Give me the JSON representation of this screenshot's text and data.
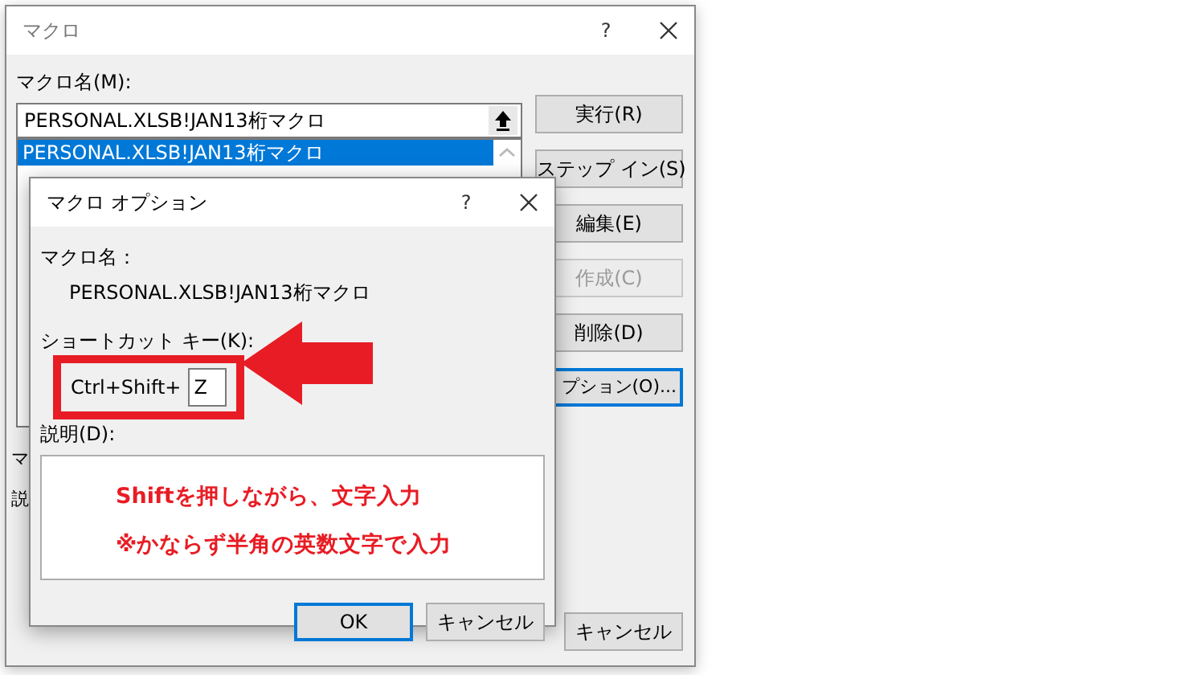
{
  "macro_dialog": {
    "title": "マクロ",
    "help": "?",
    "name_label": "マクロ名(M):",
    "name_value": "PERSONAL.XLSB!JAN13桁マクロ",
    "list_items": [
      {
        "text": "PERSONAL.XLSB!JAN13桁マクロ",
        "selected": true
      }
    ],
    "buttons": [
      {
        "label": "実行(R)",
        "disabled": false,
        "focused": false
      },
      {
        "label": "ステップ イン(S)",
        "disabled": false,
        "focused": false
      },
      {
        "label": "編集(E)",
        "disabled": false,
        "focused": false
      },
      {
        "label": "作成(C)",
        "disabled": true,
        "focused": false
      },
      {
        "label": "削除(D)",
        "disabled": false,
        "focused": false
      },
      {
        "label": "プション(O)...",
        "disabled": false,
        "focused": true
      }
    ],
    "partial_labels": [
      "マ",
      "説"
    ],
    "cancel_button": "キャンセル"
  },
  "options_dialog": {
    "title": "マクロ オプション",
    "help": "?",
    "name_label": "マクロ名：",
    "name_value": "PERSONAL.XLSB!JAN13桁マクロ",
    "shortcut_label": "ショートカット キー(K):",
    "shortcut_prefix": "Ctrl+Shift+",
    "shortcut_key": "Z",
    "description_label": "説明(D):",
    "description_lines": [
      "Shiftを押しながら、文字入力",
      "※かならず半角の英数文字で入力"
    ],
    "ok_button": "OK",
    "cancel_button": "キャンセル"
  }
}
